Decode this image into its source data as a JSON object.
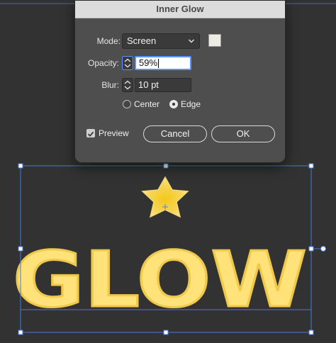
{
  "dialog": {
    "title": "Inner Glow",
    "mode_label": "Mode:",
    "mode_value": "Screen",
    "glow_color": "#ecebe4",
    "opacity_label": "Opacity:",
    "opacity_value": "59%",
    "blur_label": "Blur:",
    "blur_value": "10 pt",
    "source_options": [
      {
        "label": "Center",
        "selected": false
      },
      {
        "label": "Edge",
        "selected": true
      }
    ],
    "preview_label": "Preview",
    "preview_checked": true,
    "cancel_label": "Cancel",
    "ok_label": "OK"
  },
  "artwork": {
    "text": "GLOW",
    "fill_color": "#ffe27a",
    "glow_color": "#f4d04a",
    "star_color": "#f6c81e"
  },
  "icons": {
    "dropdown": "chevron-down-icon",
    "stepper": "up-down-stepper-icon",
    "checkbox": "checkmark-icon"
  }
}
